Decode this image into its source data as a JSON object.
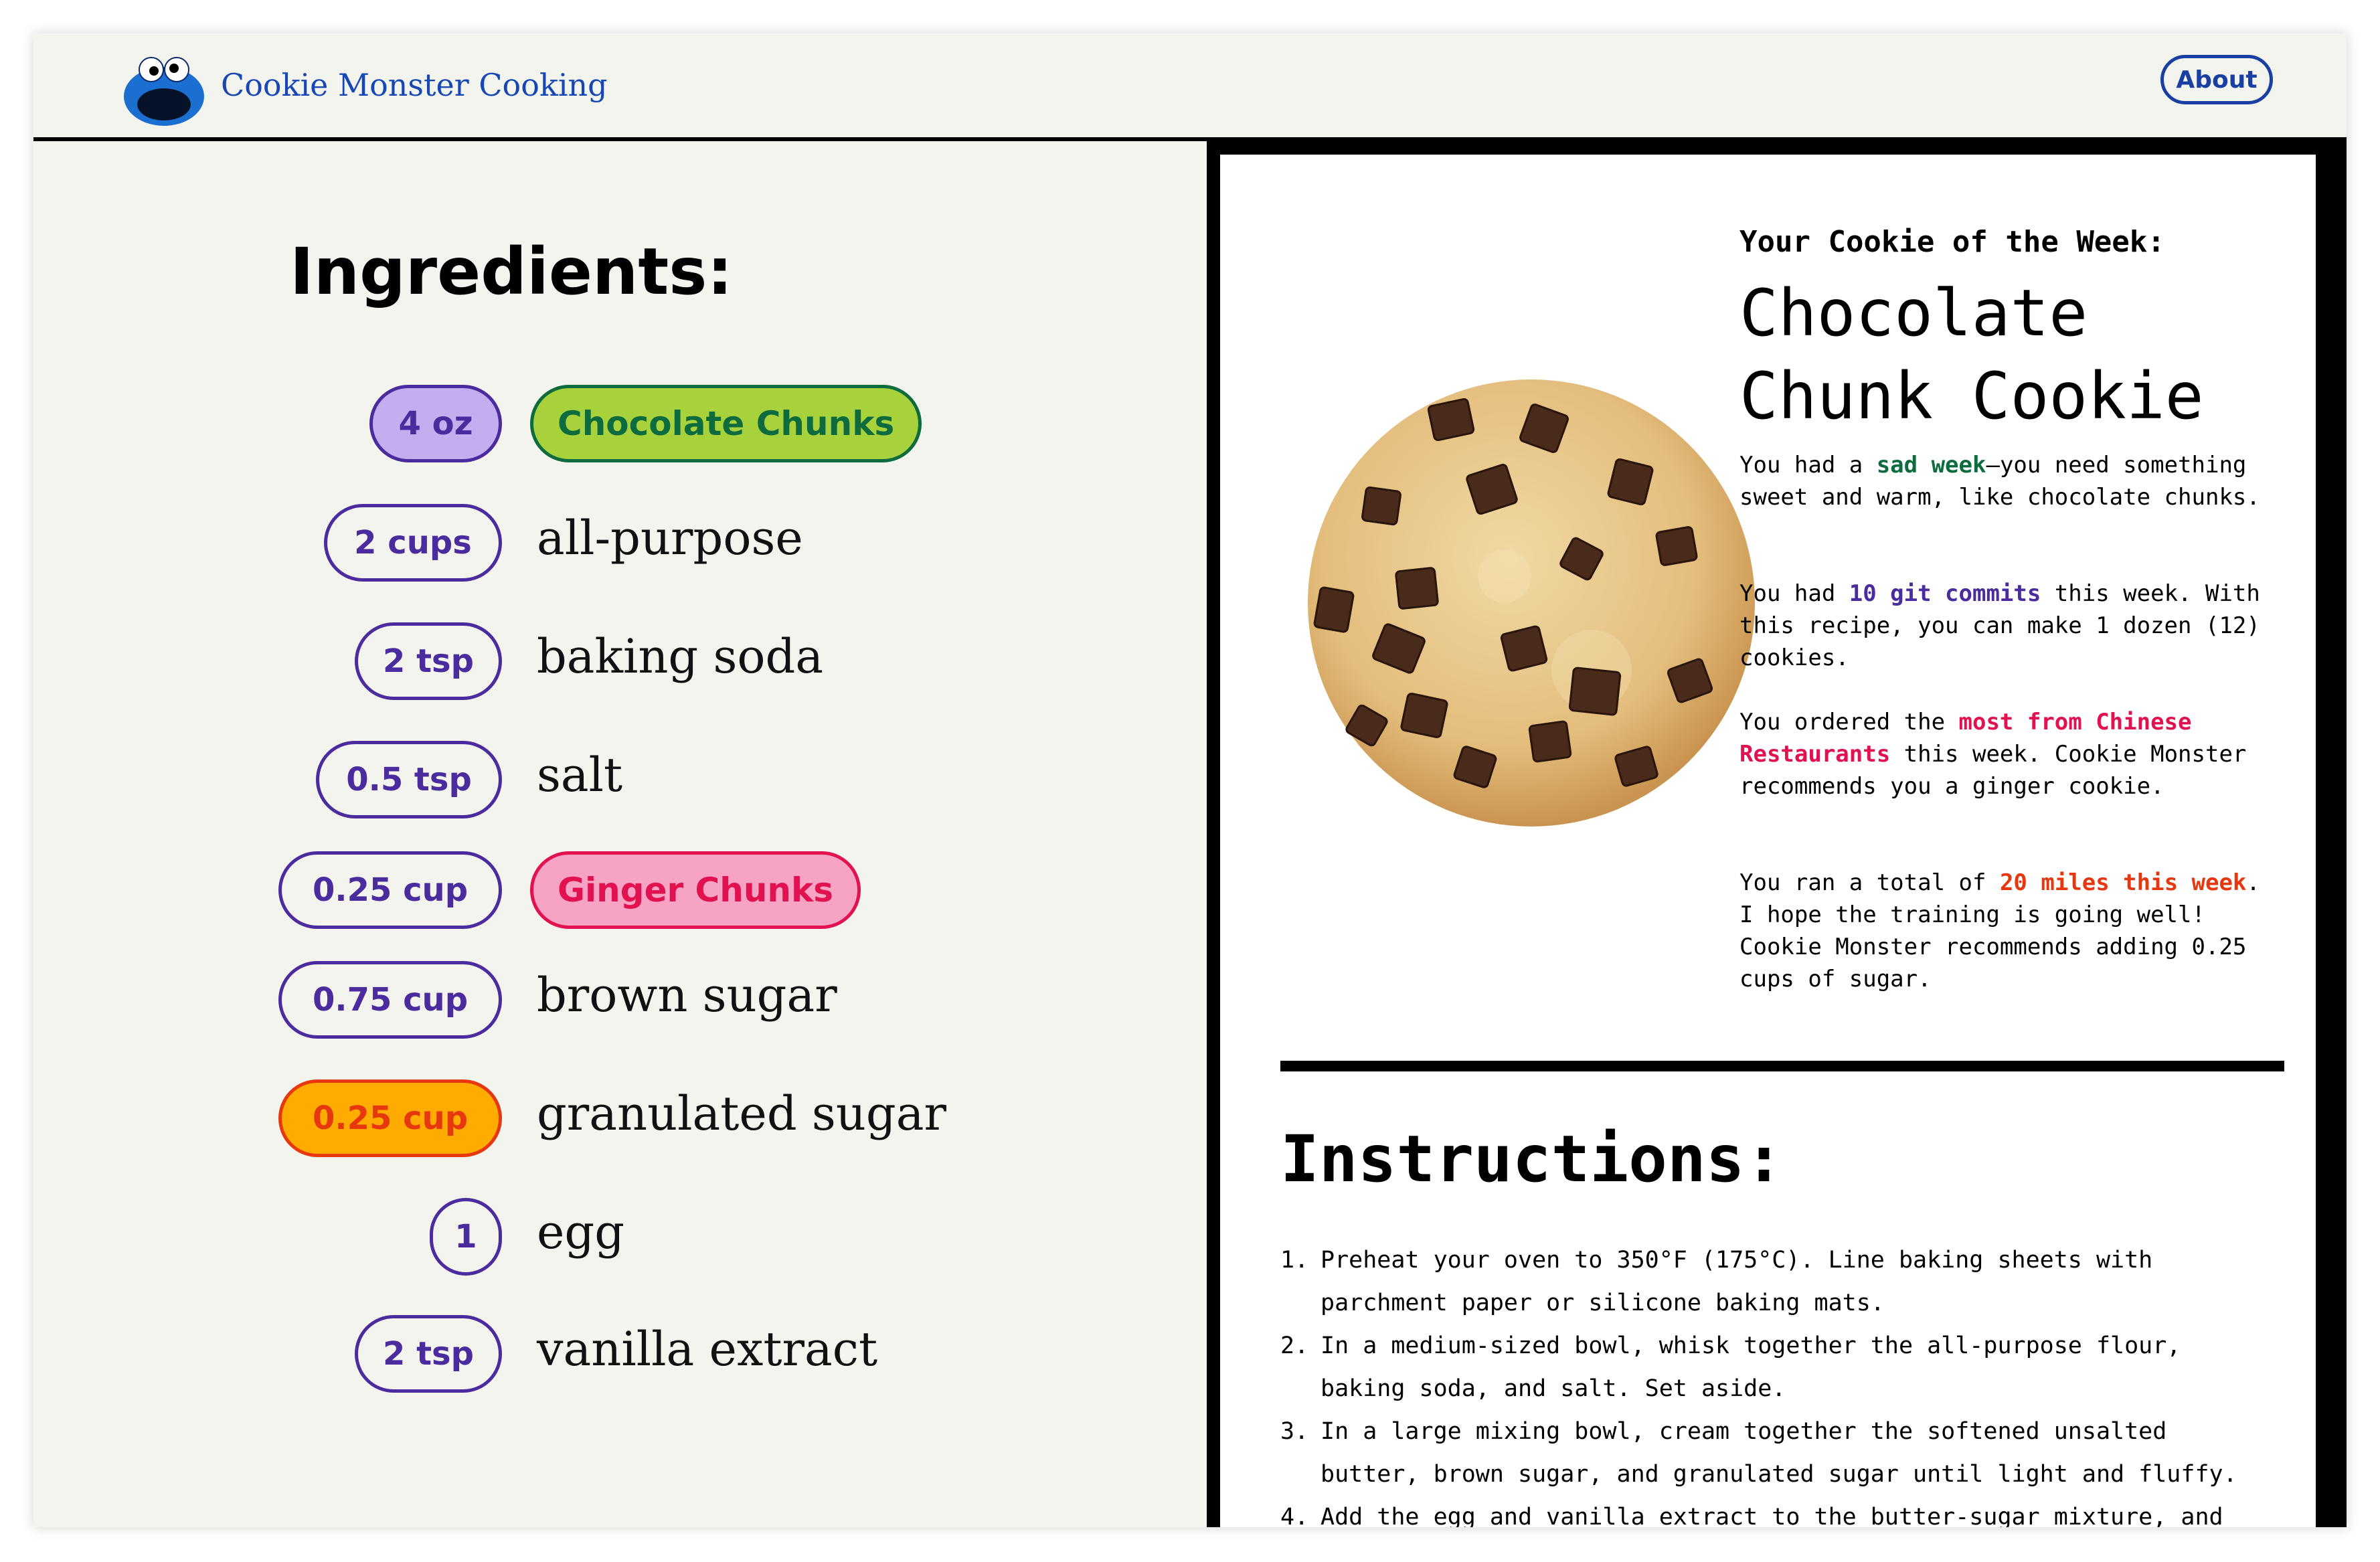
{
  "header": {
    "brand": "Cookie Monster Cooking",
    "about_label": "About",
    "logo_icon": "cookie-monster-logo-icon"
  },
  "ingredients": {
    "title": "Ingredients:",
    "items": [
      {
        "qty": "4 oz",
        "name": "Chocolate Chunks",
        "highlight": "green"
      },
      {
        "qty": "2 cups",
        "name": "all-purpose",
        "highlight": "none"
      },
      {
        "qty": "2 tsp",
        "name": "baking soda",
        "highlight": "none"
      },
      {
        "qty": "0.5 tsp",
        "name": "salt",
        "highlight": "none"
      },
      {
        "qty": "0.25 cup",
        "name": "Ginger Chunks",
        "highlight": "pink"
      },
      {
        "qty": "0.75 cup",
        "name": "brown sugar",
        "highlight": "none"
      },
      {
        "qty": "0.25 cup",
        "name": "granulated sugar",
        "highlight": "orange"
      },
      {
        "qty": "1",
        "name": "egg",
        "highlight": "none"
      },
      {
        "qty": "2 tsp",
        "name": "vanilla extract",
        "highlight": "none"
      }
    ]
  },
  "colors": {
    "purple": "#4a2c9e",
    "purple_fill": "#c5aef0",
    "green_fill": "#a8d23c",
    "green_text": "#0e6b3d",
    "pink_fill": "#f6a3c4",
    "pink_text": "#e1124f",
    "orange_fill": "#ffab00",
    "orange_text": "#e6370f",
    "brand_blue": "#1746b5"
  },
  "cookie_of_week": {
    "label": "Your Cookie of the Week:",
    "name": "Chocolate Chunk Cookie",
    "image_icon": "chocolate-chunk-cookie-image",
    "messages": [
      {
        "parts": [
          {
            "text": "You had a ",
            "style": "plain"
          },
          {
            "text": "sad week",
            "style": "green"
          },
          {
            "text": "—you need something sweet and warm, like chocolate chunks.",
            "style": "plain"
          }
        ]
      },
      {
        "parts": [
          {
            "text": "You had ",
            "style": "plain"
          },
          {
            "text": "10 git commits",
            "style": "purple"
          },
          {
            "text": " this week. With this recipe, you can make 1 dozen (12) cookies.",
            "style": "plain"
          }
        ]
      },
      {
        "parts": [
          {
            "text": "You ordered the ",
            "style": "plain"
          },
          {
            "text": "most from Chinese Restaurants",
            "style": "pink"
          },
          {
            "text": " this week. Cookie Monster recommends you a ginger cookie.",
            "style": "plain"
          }
        ]
      },
      {
        "parts": [
          {
            "text": "You ran a total of ",
            "style": "plain"
          },
          {
            "text": "20 miles this week",
            "style": "orange"
          },
          {
            "text": ". I hope the training is going well! Cookie Monster recommends adding 0.25 cups of sugar.",
            "style": "plain"
          }
        ]
      }
    ]
  },
  "instructions": {
    "title": "Instructions:",
    "steps": [
      "Preheat your oven to 350°F (175°C). Line baking sheets with parchment paper or silicone baking mats.",
      "In a medium-sized bowl, whisk together the all-purpose flour, baking soda, and salt. Set aside.",
      "In a large mixing bowl, cream together the softened unsalted butter, brown sugar, and granulated sugar until light and fluffy.",
      "Add the egg and vanilla extract to the butter-sugar mixture, and"
    ]
  }
}
